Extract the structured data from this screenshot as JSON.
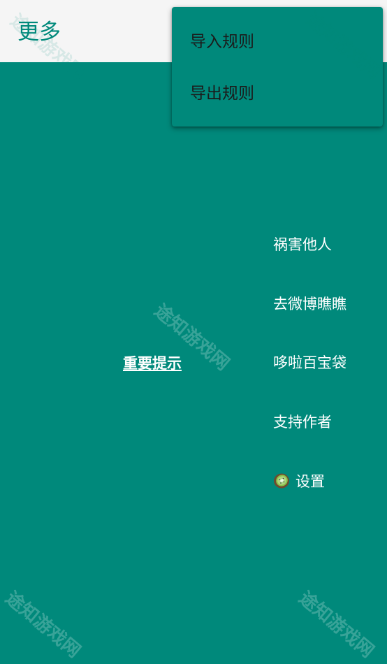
{
  "appbar": {
    "title": "更多"
  },
  "popup_menu": {
    "items": [
      {
        "label": "导入规则"
      },
      {
        "label": "导出规则"
      }
    ]
  },
  "main": {
    "notice_link": "重要提示"
  },
  "side_menu": {
    "items": [
      {
        "label": "祸害他人"
      },
      {
        "label": "去微博瞧瞧"
      },
      {
        "label": "哆啦百宝袋"
      },
      {
        "label": "支持作者"
      },
      {
        "label": "设置",
        "icon": "kiwi-icon"
      }
    ]
  },
  "watermark": {
    "text": "途知游戏网"
  },
  "colors": {
    "primary": "#00897B",
    "appbar_bg": "#F5F5F5",
    "text_on_primary": "#FFFFFF"
  }
}
